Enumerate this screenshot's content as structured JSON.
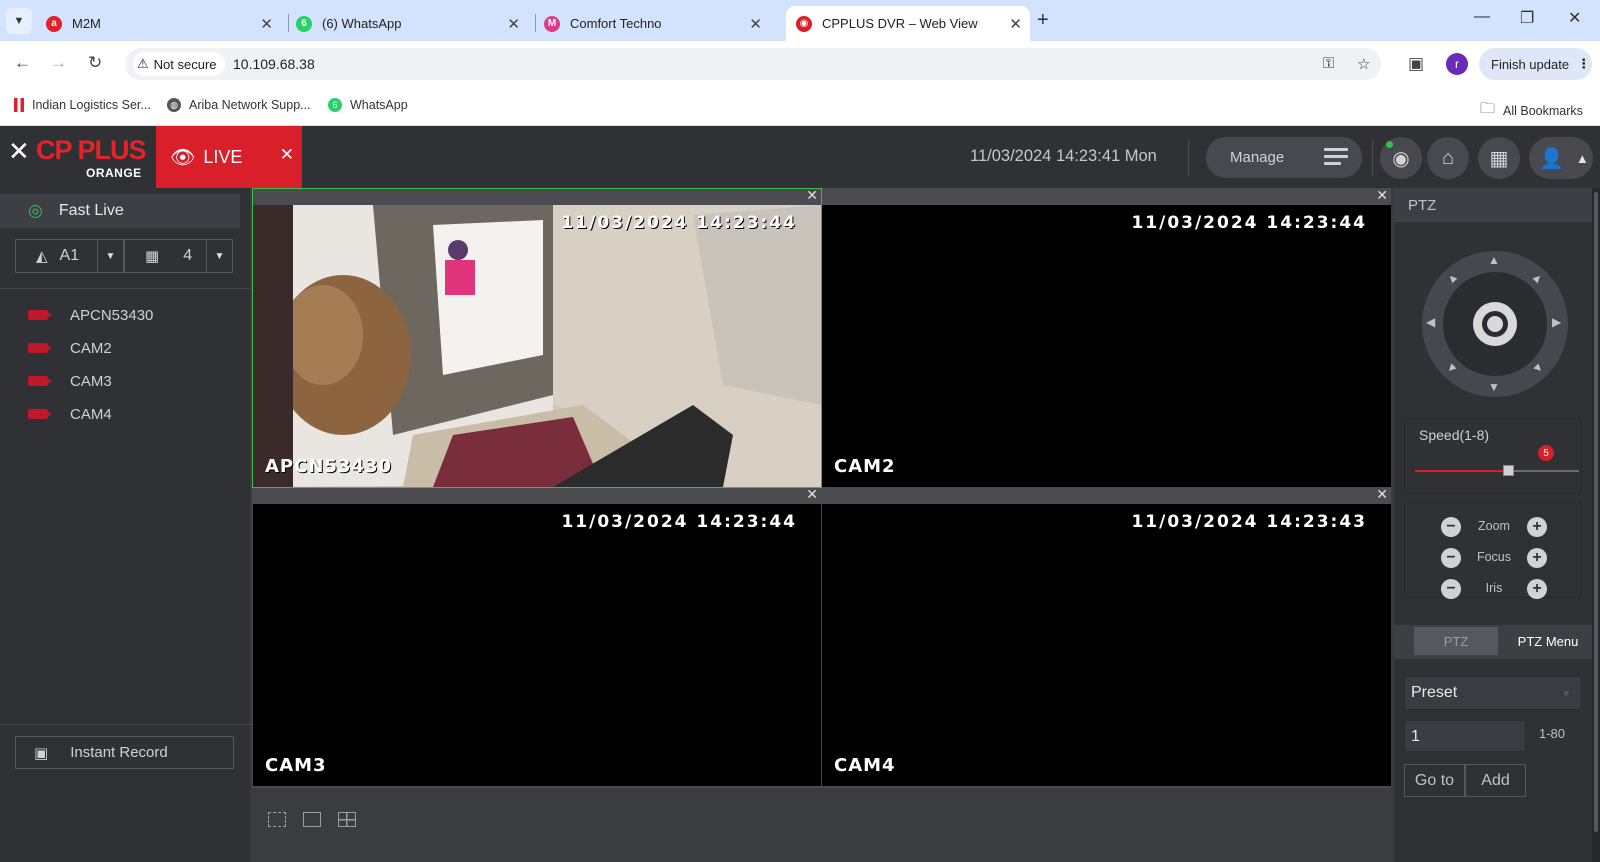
{
  "browser": {
    "tabs": [
      {
        "title": "M2M"
      },
      {
        "title": "(6) WhatsApp"
      },
      {
        "title": "Comfort Techno"
      },
      {
        "title": "CPPLUS DVR – Web View"
      }
    ],
    "security_label": "Not secure",
    "url": "10.109.68.38",
    "profile_initial": "r",
    "finish_update_label": "Finish update",
    "bookmarks": [
      {
        "label": "Indian Logistics Ser..."
      },
      {
        "label": "Ariba Network Supp..."
      },
      {
        "label": "WhatsApp"
      }
    ],
    "all_bookmarks_label": "All Bookmarks"
  },
  "dvr": {
    "logo_text": "CP PLUS",
    "logo_sub": "ORANGE",
    "live_tab_label": "LIVE",
    "datetime": "11/03/2024 14:23:41 Mon",
    "manage_label": "Manage",
    "fast_live_label": "Fast Live",
    "stream_select": "A1",
    "layout_select": "4",
    "cameras": [
      {
        "name": "APCN53430"
      },
      {
        "name": "CAM2"
      },
      {
        "name": "CAM3"
      },
      {
        "name": "CAM4"
      }
    ],
    "instant_record_label": "Instant Record",
    "video_cells": [
      {
        "name": "APCN53430",
        "timestamp": "11/03/2024 14:23:44"
      },
      {
        "name": "CAM2",
        "timestamp": "11/03/2024 14:23:44"
      },
      {
        "name": "CAM3",
        "timestamp": "11/03/2024 14:23:44"
      },
      {
        "name": "CAM4",
        "timestamp": "11/03/2024 14:23:43"
      }
    ],
    "ptz": {
      "header": "PTZ",
      "speed_label": "Speed(1-8)",
      "speed_value": "5",
      "speed_fraction": 0.57,
      "zoom_label": "Zoom",
      "focus_label": "Focus",
      "iris_label": "Iris",
      "tab_ptz": "PTZ",
      "tab_ptz_menu": "PTZ Menu",
      "preset_label": "Preset",
      "preset_number": "1",
      "preset_range": "1-80",
      "goto_label": "Go to",
      "add_label": "Add"
    }
  }
}
